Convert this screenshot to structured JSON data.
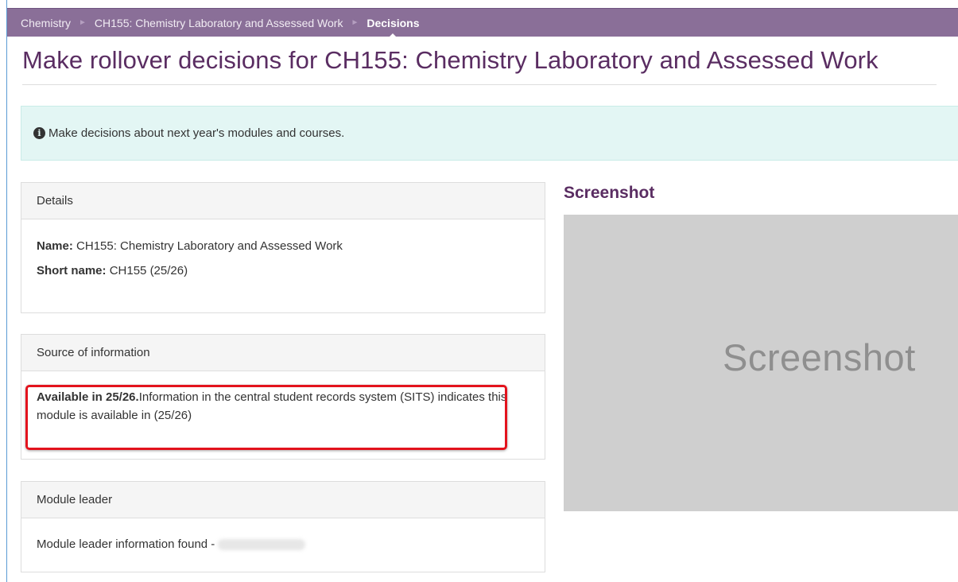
{
  "breadcrumb": {
    "items": [
      {
        "label": "Chemistry"
      },
      {
        "label": "CH155: Chemistry Laboratory and Assessed Work"
      },
      {
        "label": "Decisions"
      }
    ],
    "separator": "►"
  },
  "page": {
    "title": "Make rollover decisions for CH155: Chemistry Laboratory and Assessed Work"
  },
  "alert": {
    "icon": "info-icon",
    "text": "Make decisions about next year's modules and courses."
  },
  "details": {
    "heading": "Details",
    "name_label": "Name:",
    "name_value": "CH155: Chemistry Laboratory and Assessed Work",
    "short_label": "Short name:",
    "short_value": "CH155",
    "short_year": "(25/26)"
  },
  "source": {
    "heading": "Source of information",
    "status": "Available in 25/26.",
    "text": "Information in the central student records system (SITS) indicates this module is available in",
    "year": "(25/26)"
  },
  "leader": {
    "heading": "Module leader",
    "text": "Module leader information found -"
  },
  "screenshot": {
    "heading": "Screenshot",
    "placeholder": "Screenshot"
  },
  "colors": {
    "breadcrumb_bg": "#8a6f98",
    "title": "#5a2d62",
    "alert_bg": "#e3f6f4",
    "highlight": "#e3131d"
  }
}
